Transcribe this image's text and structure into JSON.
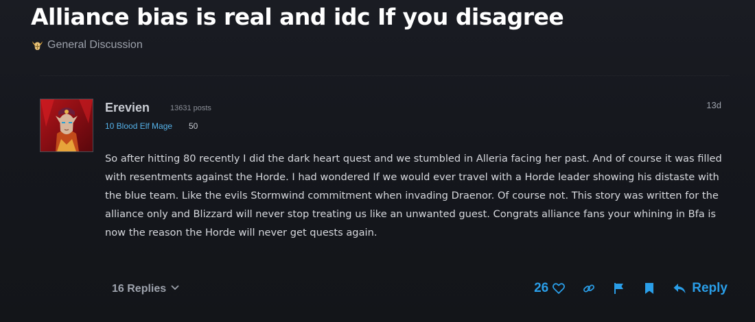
{
  "topic": {
    "title": "Alliance bias is real and idc If you disagree",
    "category": "General Discussion"
  },
  "post": {
    "username": "Erevien",
    "post_count": "13631 posts",
    "character_info": "10 Blood Elf Mage",
    "item_level": "50",
    "date": "13d",
    "body": "So after hitting 80 recently I did the dark heart quest and we stumbled in Alleria facing her past. And of course it was filled with resentments against the Horde. I had wondered If we would ever travel with a Horde leader showing his distaste with the blue team. Like the evils Stormwind commitment when invading Draenor. Of course not. This story was written for the alliance only and Blizzard will never stop treating us like an unwanted guest. Congrats alliance fans your whining in Bfa is now the reason the Horde will never get quests again.",
    "replies_label": "16 Replies",
    "like_count": "26",
    "reply_label": "Reply"
  },
  "icons": {
    "category": "horned-helmet-icon",
    "replies_toggle": "chevron-down-icon",
    "like": "heart-icon",
    "share": "link-icon",
    "flag": "flag-icon",
    "bookmark": "bookmark-icon",
    "reply": "reply-arrow-icon"
  },
  "colors": {
    "accent": "#2a9ee8",
    "class_color": "#56b4ec",
    "background": "#15171d"
  }
}
